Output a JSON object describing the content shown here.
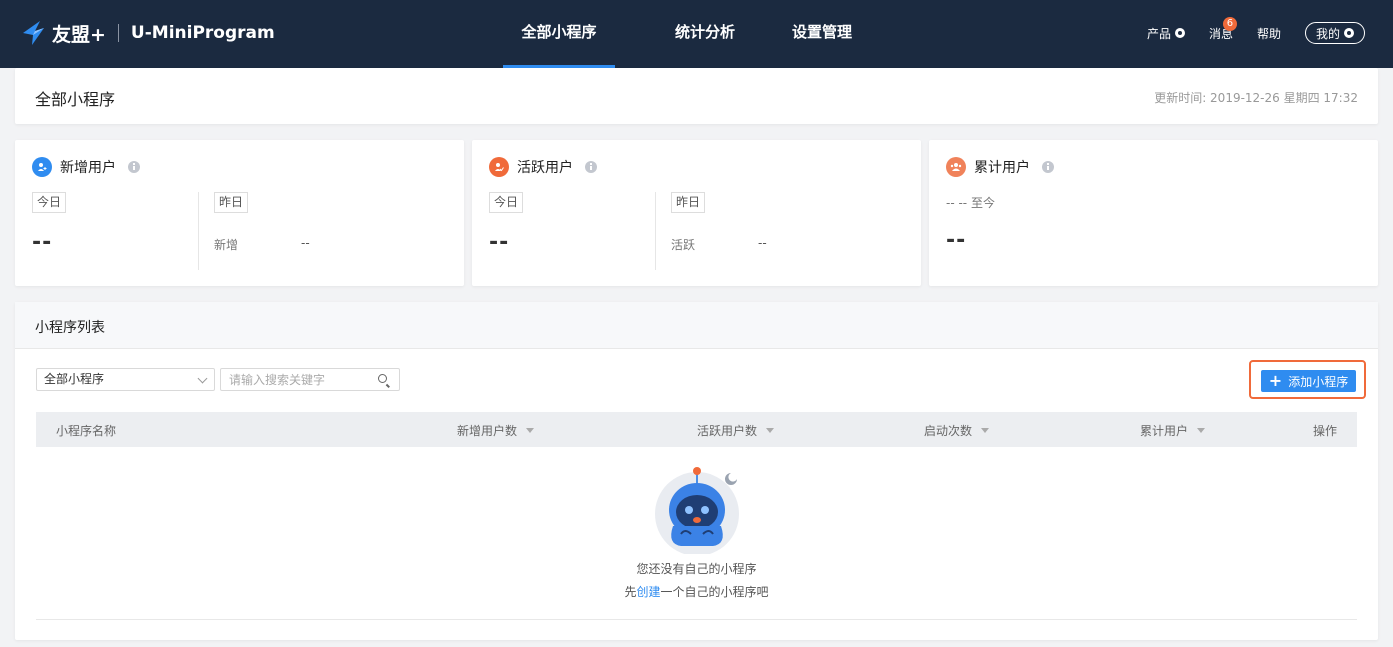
{
  "brand": {
    "name": "友盟+",
    "product": "U-MiniProgram"
  },
  "nav": {
    "tabs": [
      "全部小程序",
      "统计分析",
      "设置管理"
    ],
    "active_index": 0
  },
  "right_nav": {
    "product_label": "产品",
    "messages_label": "消息",
    "messages_count": "6",
    "help_label": "帮助",
    "my_label": "我的"
  },
  "header": {
    "title": "全部小程序",
    "update_time": "更新时间: 2019-12-26 星期四 17:32"
  },
  "stats": {
    "new_users": {
      "title": "新增用户",
      "today_tag": "今日",
      "today_value": "--",
      "yesterday_tag": "昨日",
      "sub_label": "新增",
      "sub_value": "--"
    },
    "active_users": {
      "title": "活跃用户",
      "today_tag": "今日",
      "today_value": "--",
      "yesterday_tag": "昨日",
      "sub_label": "活跃",
      "sub_value": "--"
    },
    "total_users": {
      "title": "累计用户",
      "range": "-- -- 至今",
      "value": "--"
    }
  },
  "list": {
    "title": "小程序列表",
    "filter_selected": "全部小程序",
    "search_placeholder": "请输入搜索关键字",
    "add_button": "添加小程序",
    "columns": [
      "小程序名称",
      "新增用户数",
      "活跃用户数",
      "启动次数",
      "累计用户",
      "操作"
    ],
    "rows": [],
    "empty_text": "您还没有自己的小程序",
    "create_prefix": "先",
    "create_link": "创建",
    "create_suffix": "一个自己的小程序吧"
  },
  "colors": {
    "topbar_bg": "#1b2a40",
    "accent_blue": "#2f8cf0",
    "highlight_orange": "#f06a3a"
  }
}
